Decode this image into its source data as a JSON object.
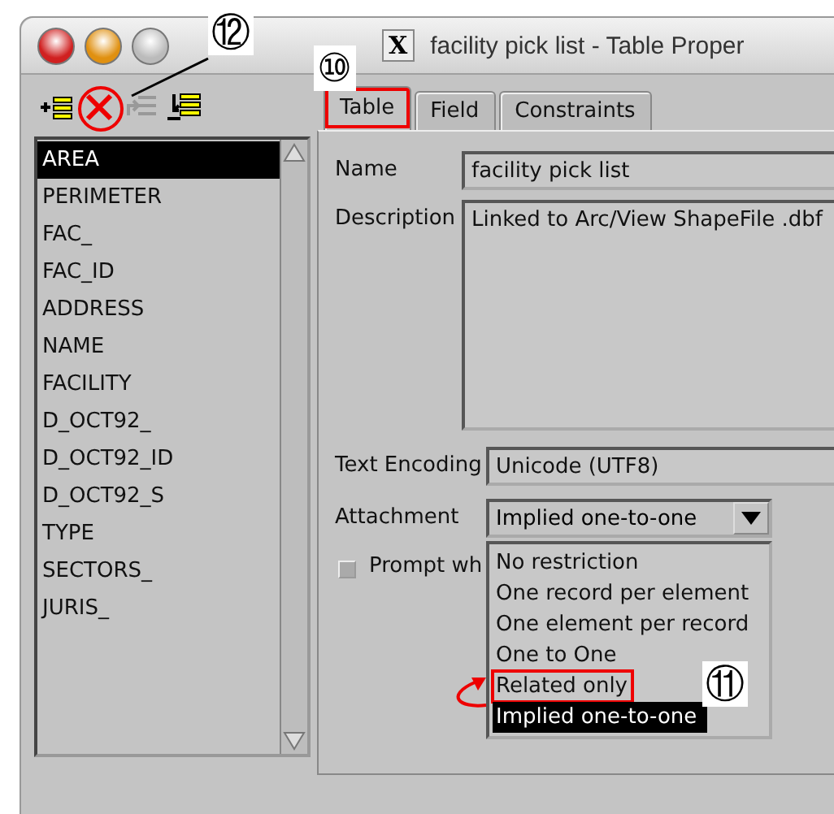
{
  "window": {
    "title": "facility pick list - Table Proper",
    "app_glyph": "X"
  },
  "fields": [
    {
      "label": "AREA",
      "selected": true
    },
    {
      "label": "PERIMETER",
      "selected": false
    },
    {
      "label": "FAC_",
      "selected": false
    },
    {
      "label": "FAC_ID",
      "selected": false
    },
    {
      "label": "ADDRESS",
      "selected": false
    },
    {
      "label": "NAME",
      "selected": false
    },
    {
      "label": "FACILITY",
      "selected": false
    },
    {
      "label": "D_OCT92_",
      "selected": false
    },
    {
      "label": "D_OCT92_ID",
      "selected": false
    },
    {
      "label": "D_OCT92_S",
      "selected": false
    },
    {
      "label": "TYPE",
      "selected": false
    },
    {
      "label": "SECTORS_",
      "selected": false
    },
    {
      "label": "JURIS_",
      "selected": false
    }
  ],
  "tabs": [
    {
      "label": "Table",
      "selected": true,
      "highlighted": true
    },
    {
      "label": "Field",
      "selected": false,
      "highlighted": false
    },
    {
      "label": "Constraints",
      "selected": false,
      "highlighted": false
    }
  ],
  "form": {
    "name_label": "Name",
    "name": "facility pick list",
    "description_label": "Description",
    "description": "Linked to Arc/View ShapeFile .dbf",
    "encoding_label": "Text Encoding",
    "encoding": "Unicode (UTF8)",
    "attachment_label": "Attachment",
    "attachment": "Implied one-to-one",
    "prompt_label": "Prompt wh",
    "prompt_checked": false
  },
  "attachment_options": [
    {
      "label": "No restriction",
      "selected": false,
      "highlighted": false
    },
    {
      "label": "One record per element",
      "selected": false,
      "highlighted": false
    },
    {
      "label": "One element per record",
      "selected": false,
      "highlighted": false
    },
    {
      "label": "One to One",
      "selected": false,
      "highlighted": false
    },
    {
      "label": "Related only",
      "selected": false,
      "highlighted": true
    },
    {
      "label": "Implied one-to-one",
      "selected": true,
      "highlighted": false
    }
  ],
  "callouts": [
    "⑫",
    "⑩",
    "⑪"
  ]
}
